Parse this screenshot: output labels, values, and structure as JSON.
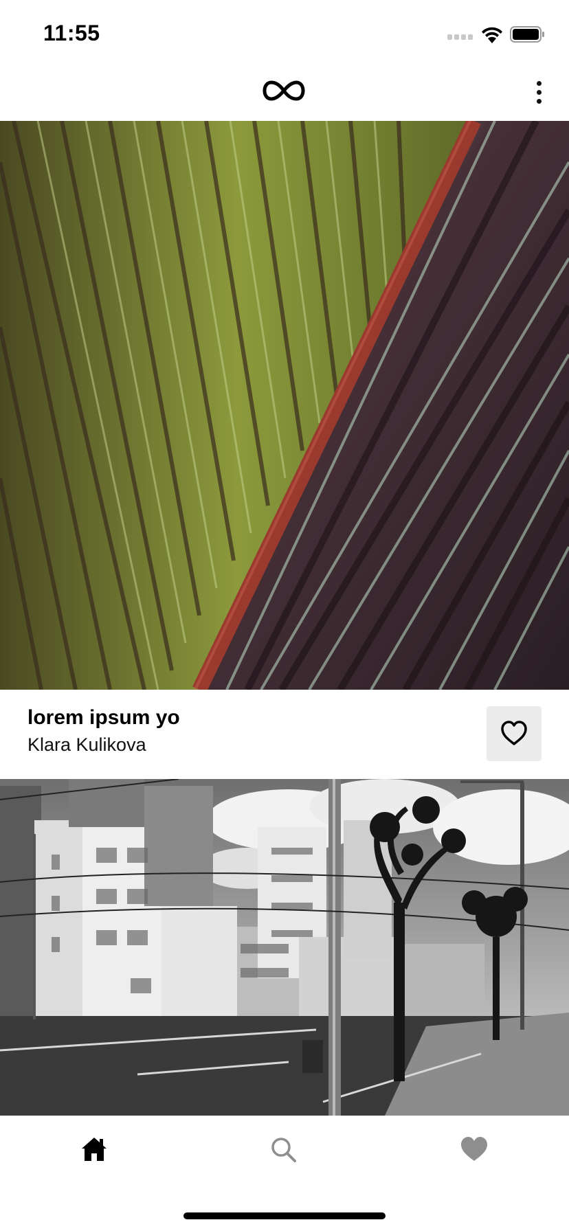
{
  "status_bar": {
    "time": "11:55",
    "icons": [
      "signal-dots-icon",
      "wifi-icon",
      "battery-icon"
    ]
  },
  "nav_bar": {
    "logo_icon": "infinity-logo-icon",
    "menu_icon": "more-vertical-icon"
  },
  "feed": {
    "cards": [
      {
        "image": "palm-leaf-photo",
        "title": "lorem ipsum yo",
        "author": "Klara Kulikova",
        "like_icon": "heart-outline-icon"
      },
      {
        "image": "city-street-bw-photo"
      }
    ]
  },
  "tab_bar": {
    "tabs": [
      {
        "name": "home",
        "icon": "home-icon",
        "active": true
      },
      {
        "name": "search",
        "icon": "search-icon",
        "active": false
      },
      {
        "name": "favorites",
        "icon": "heart-filled-icon",
        "active": false
      }
    ]
  },
  "colors": {
    "background": "#ffffff",
    "text": "#000000",
    "like_button_bg": "#ececec",
    "inactive_tab": "#8e8e8e",
    "active_tab": "#000000"
  }
}
